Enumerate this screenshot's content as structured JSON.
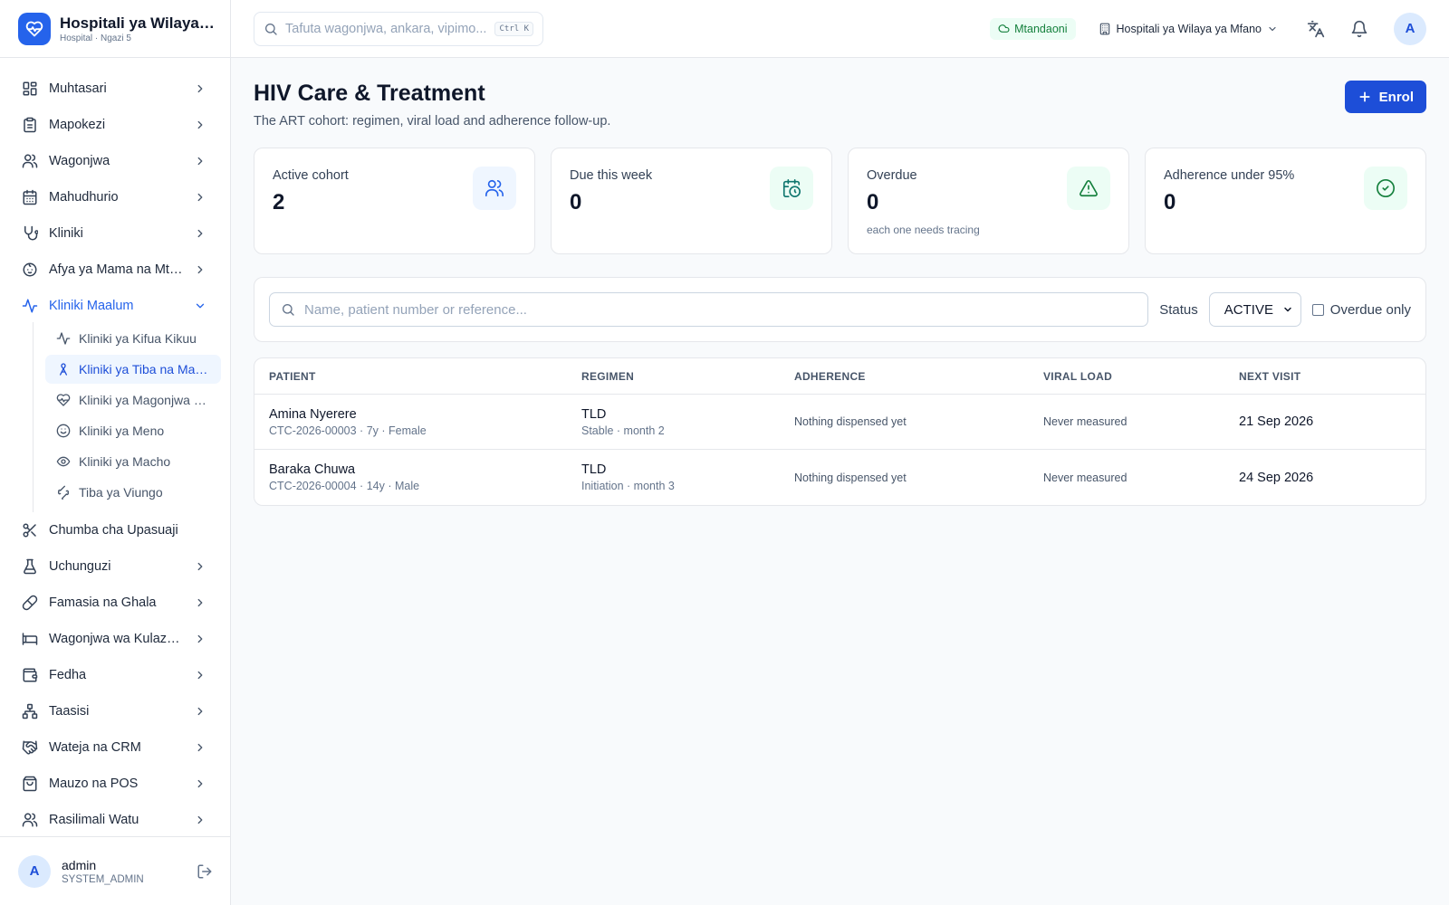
{
  "brand": {
    "name": "Hospitali ya Wilaya ya Mfano",
    "sub": "Hospital · Ngazi 5"
  },
  "nav": {
    "muhtasari": "Muhtasari",
    "mapokezi": "Mapokezi",
    "wagonjwa": "Wagonjwa",
    "mahudhurio": "Mahudhurio",
    "kliniki": "Kliniki",
    "afya_mama": "Afya ya Mama na Mtoto",
    "kliniki_maalum": "Kliniki Maalum",
    "sub": {
      "kifua": "Kliniki ya Kifua Kikuu",
      "tiba": "Kliniki ya Tiba na Matunzo",
      "magonjwa": "Kliniki ya Magonjwa Sugu",
      "meno": "Kliniki ya Meno",
      "macho": "Kliniki ya Macho",
      "viungo": "Tiba ya Viungo"
    },
    "chumba": "Chumba cha Upasuaji",
    "uchunguzi": "Uchunguzi",
    "famasia": "Famasia na Ghala",
    "kulazwa": "Wagonjwa wa Kulazwa",
    "fedha": "Fedha",
    "taasisi": "Taasisi",
    "crm": "Wateja na CRM",
    "mauzo": "Mauzo na POS",
    "rasilimali": "Rasilimali Watu"
  },
  "user": {
    "initial": "A",
    "name": "admin",
    "role": "SYSTEM_ADMIN"
  },
  "topbar": {
    "search_placeholder": "Tafuta wagonjwa, ankara, vipimo...",
    "shortcut": "Ctrl K",
    "online": "Mtandaoni",
    "facility": "Hospitali ya Wilaya ya Mfano",
    "avatar": "A"
  },
  "page": {
    "title": "HIV Care & Treatment",
    "subtitle": "The ART cohort: regimen, viral load and adherence follow-up.",
    "enrol": "Enrol"
  },
  "stats": {
    "active": {
      "label": "Active cohort",
      "value": "2"
    },
    "due": {
      "label": "Due this week",
      "value": "0"
    },
    "overdue": {
      "label": "Overdue",
      "value": "0",
      "note": "each one needs tracing"
    },
    "adherence": {
      "label": "Adherence under 95%",
      "value": "0"
    }
  },
  "filter": {
    "search_placeholder": "Name, patient number or reference...",
    "status_label": "Status",
    "status_value": "ACTIVE",
    "overdue_only": "Overdue only"
  },
  "table": {
    "headers": {
      "patient": "PATIENT",
      "regimen": "REGIMEN",
      "adherence": "ADHERENCE",
      "viral_load": "VIRAL LOAD",
      "next_visit": "NEXT VISIT"
    },
    "rows": [
      {
        "name": "Amina Nyerere",
        "meta": "CTC-2026-00003 · 7y · Female",
        "regimen": "TLD",
        "regimen_meta": "Stable · month 2",
        "adherence": "Nothing dispensed yet",
        "viral_load": "Never measured",
        "next_visit": "21 Sep 2026"
      },
      {
        "name": "Baraka Chuwa",
        "meta": "CTC-2026-00004 · 14y · Male",
        "regimen": "TLD",
        "regimen_meta": "Initiation · month 3",
        "adherence": "Nothing dispensed yet",
        "viral_load": "Never measured",
        "next_visit": "24 Sep 2026"
      }
    ]
  },
  "colors": {
    "accent": "#1d4ed8",
    "online": "#15803d",
    "stat_blue_bg": "#eff6ff",
    "stat_green_bg": "#ecfdf5"
  }
}
